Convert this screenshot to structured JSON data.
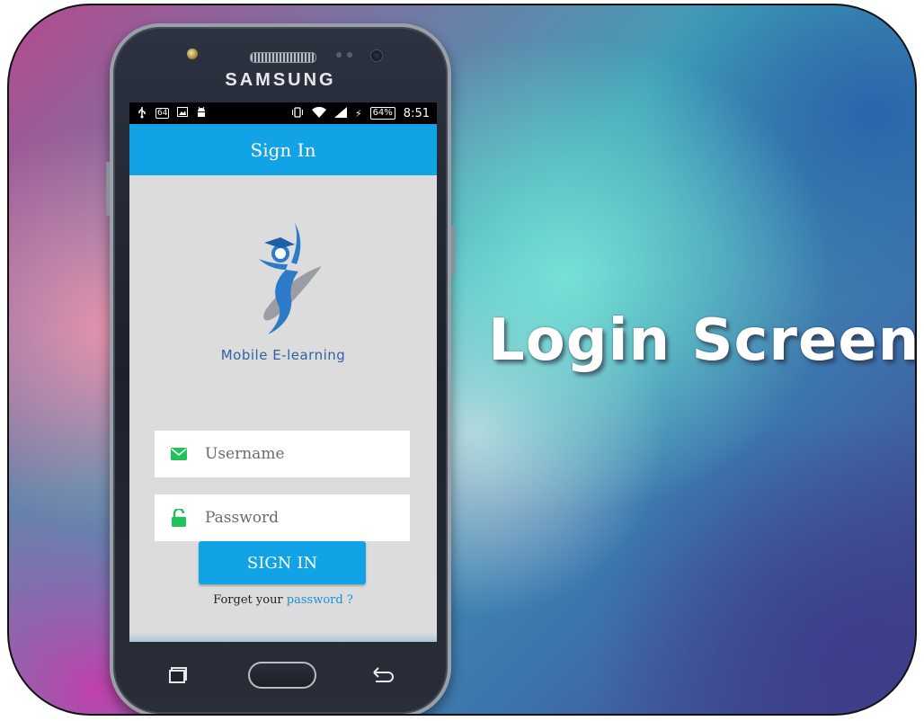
{
  "headline": "Login Screen",
  "phone": {
    "brand": "SAMSUNG"
  },
  "status_bar": {
    "left_icons": [
      "usb-icon",
      "64",
      "image-icon",
      "android-icon"
    ],
    "badge": "64",
    "battery": "64%",
    "time": "8:51",
    "right_icons": [
      "vibrate-icon",
      "wifi-icon",
      "signal-icon",
      "charging-icon"
    ]
  },
  "app_bar": {
    "title": "Sign In"
  },
  "logo": {
    "caption": "Mobile E-learning",
    "icon": "graduate-figure-logo"
  },
  "form": {
    "username_placeholder": "Username",
    "password_placeholder": "Password",
    "username_icon": "envelope-icon",
    "password_icon": "unlock-icon",
    "submit_label": "SIGN IN",
    "forgot_prefix": "Forget your",
    "forgot_link": "password ?"
  },
  "colors": {
    "primary": "#12a3e6",
    "field_icon": "#22c25a",
    "caption": "#2f63a3"
  }
}
